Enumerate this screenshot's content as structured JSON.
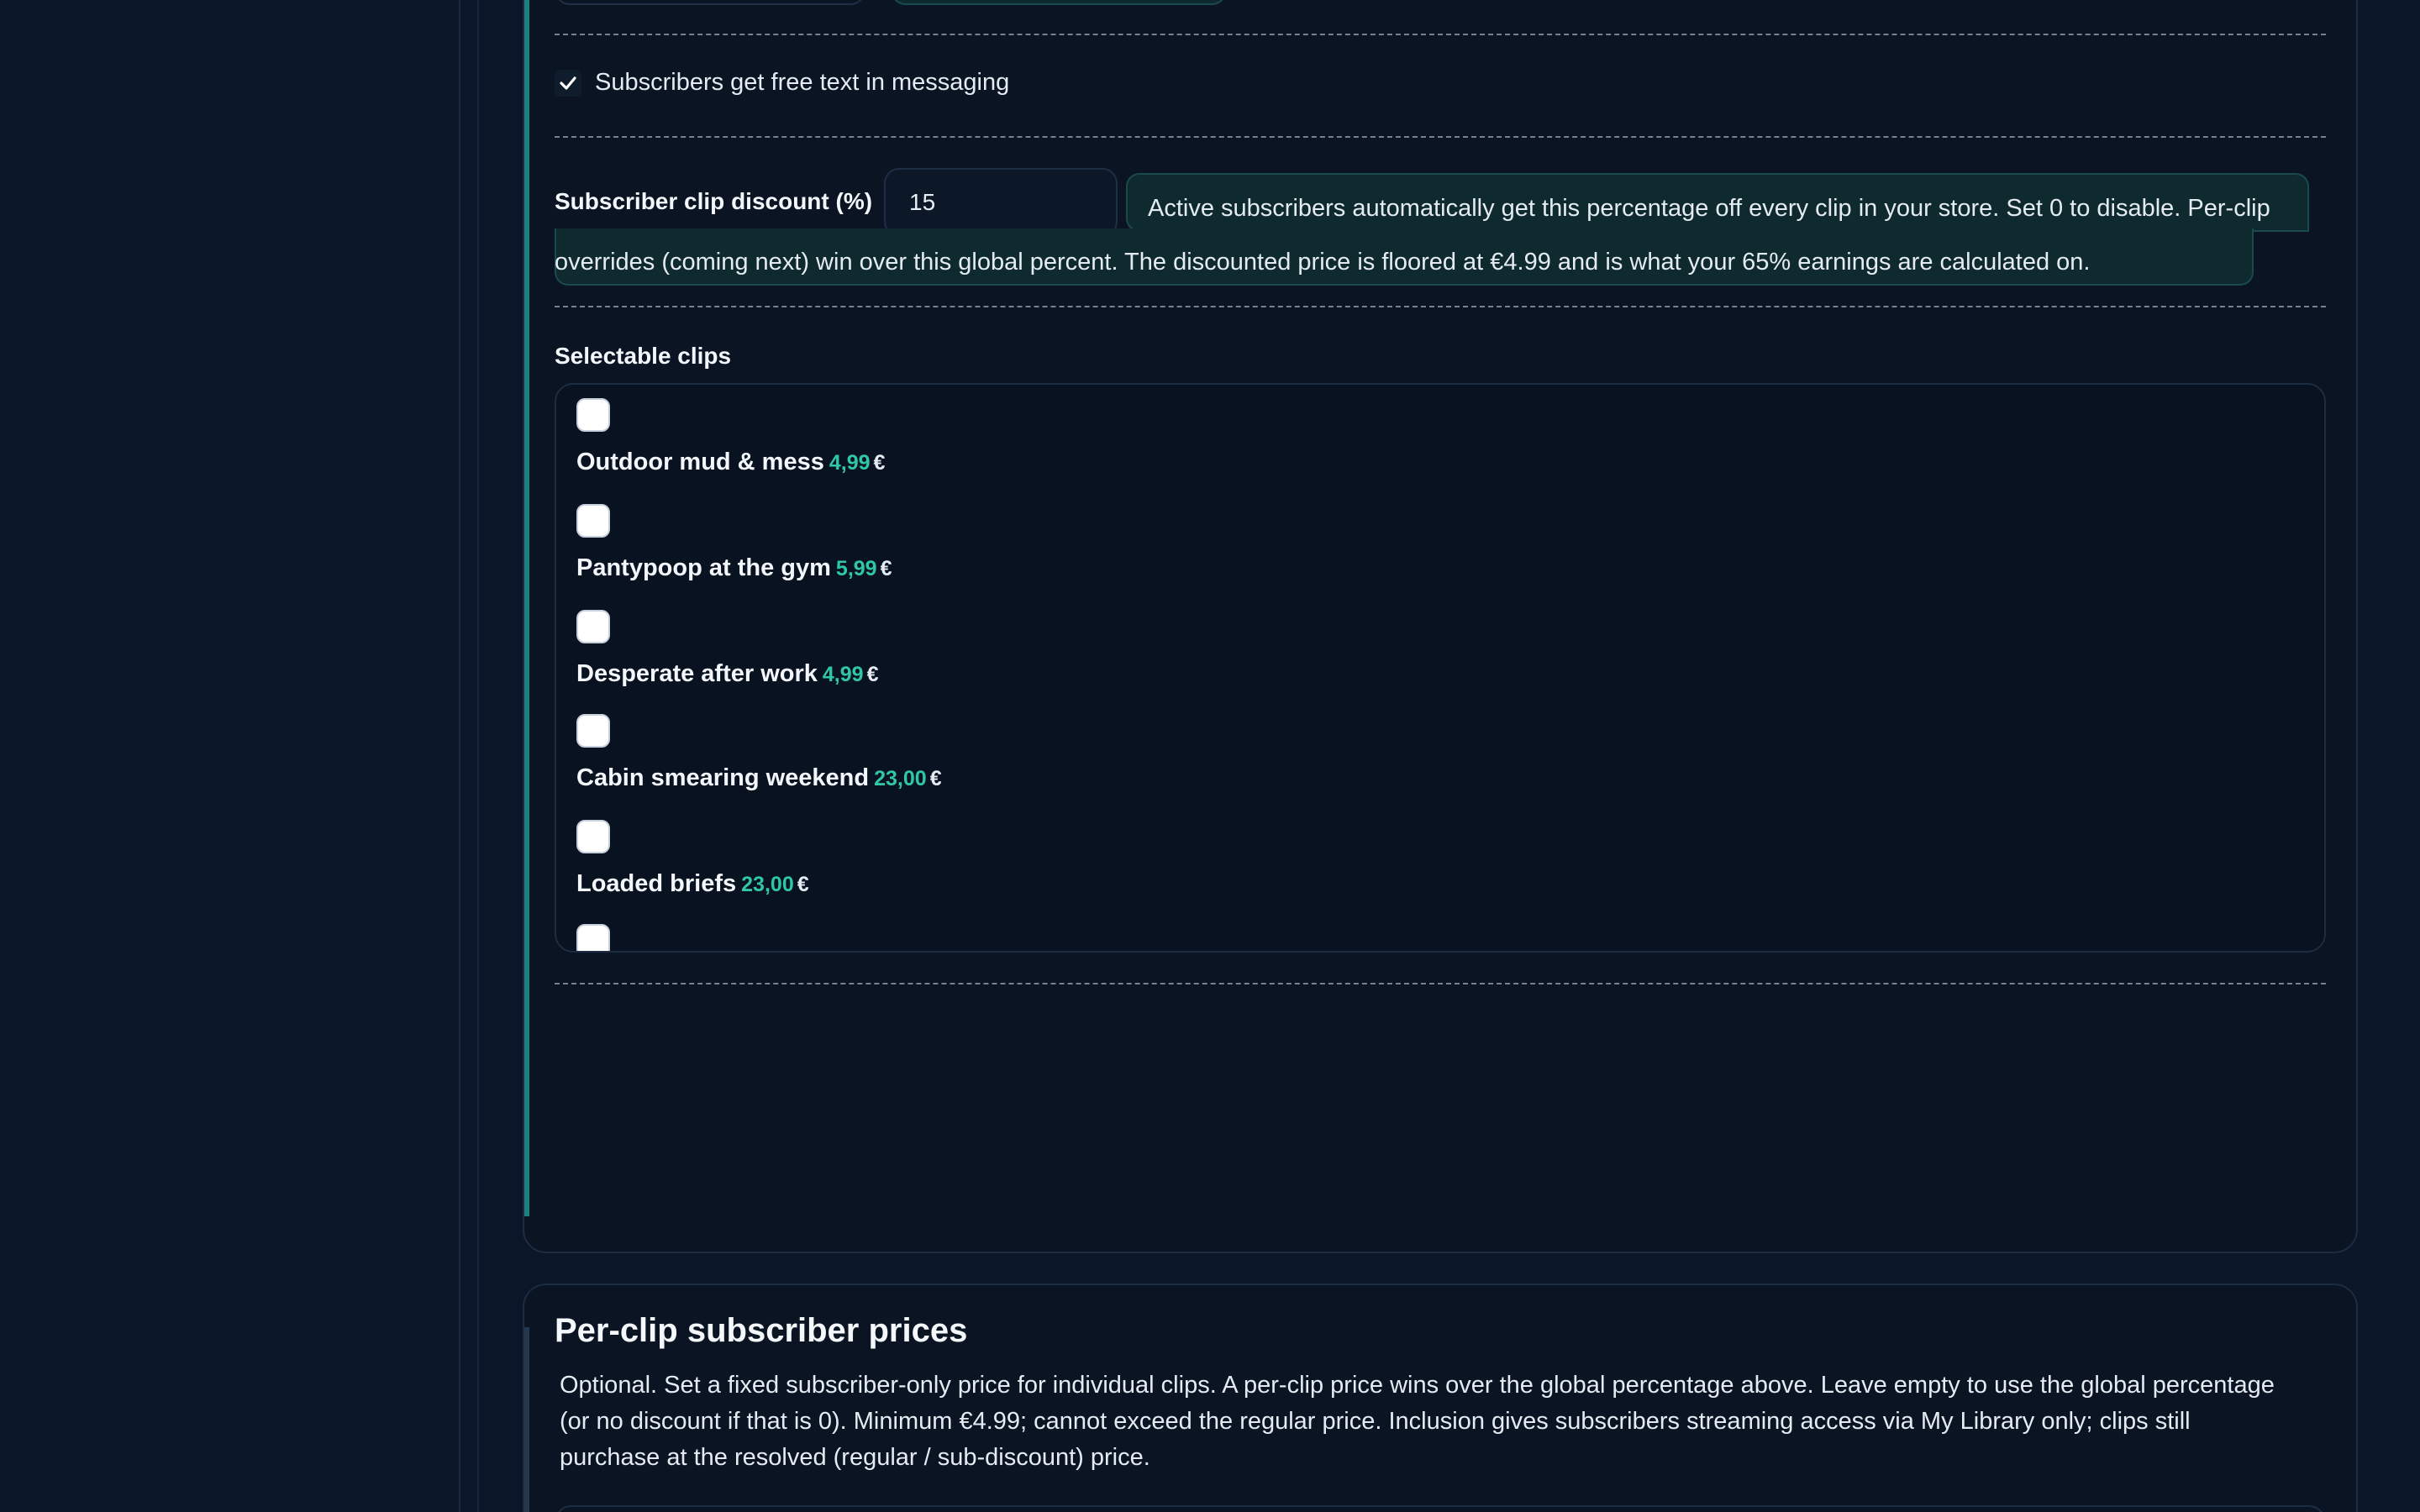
{
  "settings": {
    "free_text_label": "Subscribers get free text in messaging",
    "discount_label": "Subscriber clip discount (%)",
    "discount_value": "15",
    "discount_help": "Active subscribers automatically get this percentage off every clip in your store. Set 0 to disable. Per-clip overrides (coming next) win over this global percent. The discounted price is floored at €4.99 and is what your 65% earnings are calculated on.",
    "selectable_label": "Selectable clips"
  },
  "clips": [
    {
      "title": "Outdoor mud & mess",
      "price": "4,99",
      "currency": "€"
    },
    {
      "title": "Pantypoop at the gym",
      "price": "5,99",
      "currency": "€"
    },
    {
      "title": "Desperate after work",
      "price": "4,99",
      "currency": "€"
    },
    {
      "title": "Cabin smearing weekend",
      "price": "23,00",
      "currency": "€"
    },
    {
      "title": "Loaded briefs",
      "price": "23,00",
      "currency": "€"
    }
  ],
  "per_clip": {
    "title": "Per-clip subscriber prices",
    "description": "Optional. Set a fixed subscriber-only price for individual clips. A per-clip price wins over the global percentage above. Leave empty to use the global percentage (or no discount if that is 0). Minimum €4.99; cannot exceed the regular price. Inclusion gives subscribers streaming access via My Library only; clips still purchase at the resolved (regular / sub-discount) price."
  },
  "colors": {
    "accent": "#2fc7a7",
    "background": "#0b1628"
  }
}
